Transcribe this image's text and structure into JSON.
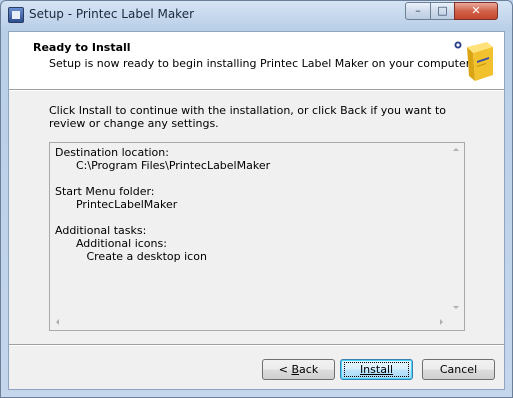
{
  "window": {
    "title": "Setup - Printec Label Maker",
    "icon": "setup-app-icon",
    "controls": {
      "minimize": "–",
      "maximize": "□",
      "close": "✕"
    }
  },
  "header": {
    "title": "Ready to Install",
    "subtitle": "Setup is now ready to begin installing Printec Label Maker on your computer.",
    "icon": "software-box-icon"
  },
  "intro": "Click Install to continue with the installation, or click Back if you want to review or change any settings.",
  "memo": {
    "text": "Destination location:\n      C:\\Program Files\\PrintecLabelMaker\n\nStart Menu folder:\n      PrintecLabelMaker\n\nAdditional tasks:\n      Additional icons:\n         Create a desktop icon"
  },
  "buttons": {
    "back_prefix": "< ",
    "back_hotkey": "B",
    "back_rest": "ack",
    "install": "Install",
    "cancel": "Cancel"
  },
  "colors": {
    "title_bar": "#b9d1ea",
    "client": "#f0f0f0",
    "header": "#ffffff",
    "install_border": "#3c7fb1"
  }
}
